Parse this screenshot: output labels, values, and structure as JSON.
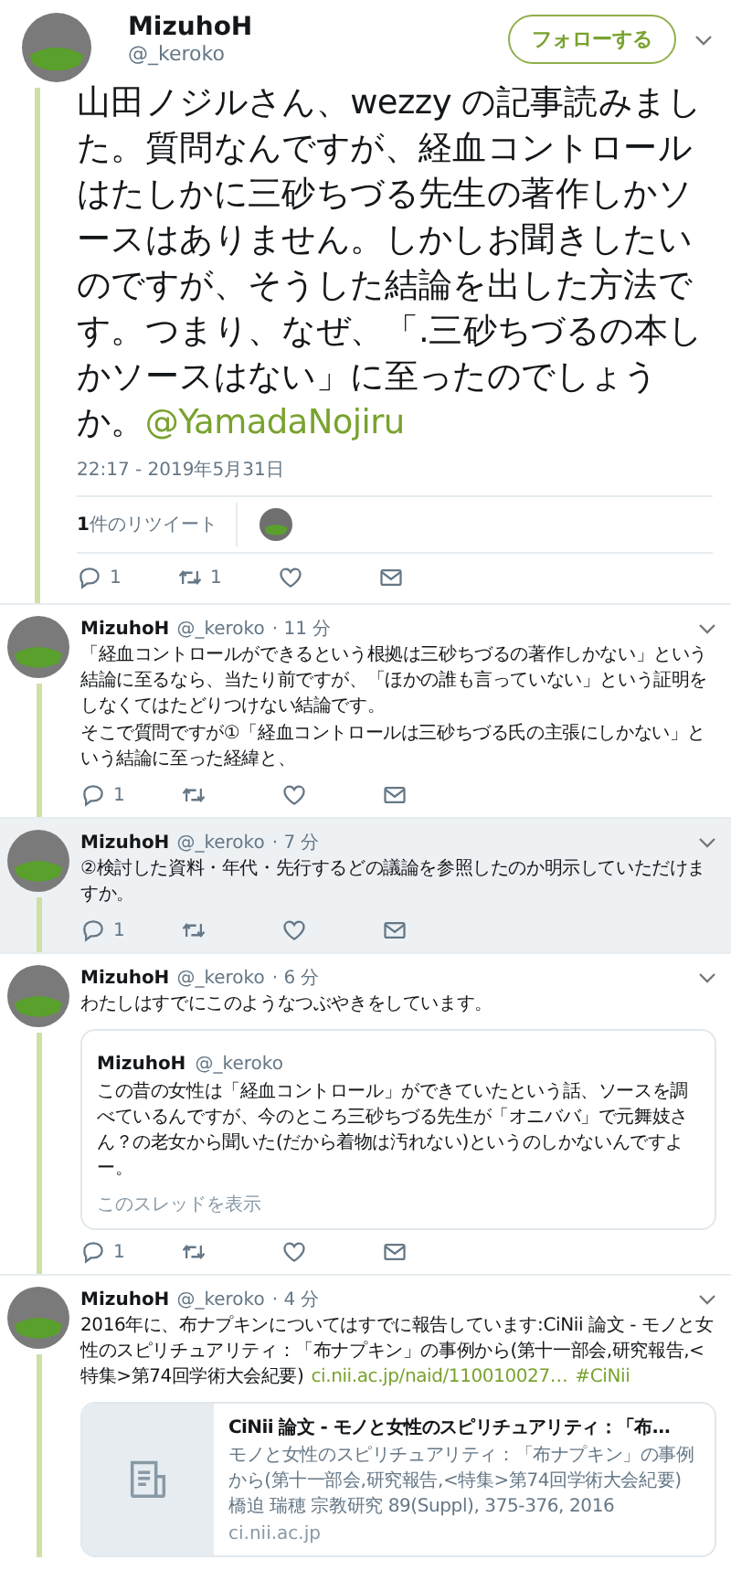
{
  "main_tweet": {
    "name": "MizuhoH",
    "handle": "@_keroko",
    "follow_button": "フォローする",
    "text": "山田ノジルさん、wezzy の記事読みました。質問なんですが、経血コントロールはたしかに三砂ちづる先生の著作しかソースはありません。しかしお聞きしたいのですが、そうした結論を出した方法です。つまり、なぜ、「.三砂ちづるの本しかソースはない」に至ったのでしょうか。",
    "mention": "@YamadaNojiru",
    "timestamp": "22:17 - 2019年5月31日",
    "retweets_label": "**1**件のリツイート",
    "reply_count": "1",
    "retweet_count": "1"
  },
  "replies": [
    {
      "name": "MizuhoH",
      "handle": "@_keroko",
      "time": "· 11 分",
      "highlighted": false,
      "text": "「経血コントロールができるという根拠は三砂ちづるの著作しかない」という結論に至るなら、当たり前ですが、「ほかの誰も言っていない」という証明をしなくてはたどりつけない結論です。",
      "text_2": "そこで質問ですが①「経血コントロールは三砂ちづる氏の主張にしかない」という結論に至った経緯と、",
      "reply_count": "1"
    },
    {
      "name": "MizuhoH",
      "handle": "@_keroko",
      "time": "· 7 分",
      "highlighted": true,
      "text": "②検討した資料・年代・先行するどの議論を参照したのか明示していただけますか。",
      "reply_count": "1"
    },
    {
      "name": "MizuhoH",
      "handle": "@_keroko",
      "time": "· 6 分",
      "highlighted": false,
      "text": "わたしはすでにこのようなつぶやきをしています。",
      "reply_count": "1",
      "quote": {
        "name": "MizuhoH",
        "handle": "@_keroko",
        "text": "この昔の女性は「経血コントロール」ができていたという話、ソースを調べているんですが、今のところ三砂ちづる先生が「オニババ」で元舞妓さん？の老女から聞いた(だから着物は汚れない)というのしかないんですよー。",
        "thread_link": "このスレッドを表示"
      }
    },
    {
      "name": "MizuhoH",
      "handle": "@_keroko",
      "time": "· 4 分",
      "highlighted": false,
      "text": "2016年に、布ナプキンについてはすでに報告しています:CiNii 論文 - モノと女性のスピリチュアリティ：「布ナプキン」の事例から(第十一部会,研究報告,<特集>第74回学術大会紀要)",
      "links": [
        "ci.nii.ac.jp/naid/110010027…",
        "#CiNii"
      ],
      "link_card": {
        "title": "CiNii 論文 - モノと女性のスピリチュアリティ：「布…",
        "description": "モノと女性のスピリチュアリティ：「布ナプキン」の事例から(第十一部会,研究報告,<特集>第74回学術大会紀要) 橋迫 瑞穂 宗教研究 89(Suppl), 375-376, 2016",
        "domain": "ci.nii.ac.jp"
      }
    }
  ]
}
